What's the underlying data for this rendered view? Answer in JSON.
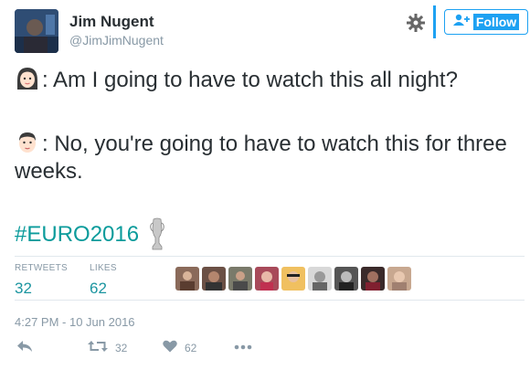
{
  "user": {
    "name": "Jim Nugent",
    "handle": "@JimJimNugent"
  },
  "follow": {
    "label": "Follow"
  },
  "tweet": {
    "line1": ": Am I going to have to watch this all night?",
    "line2": ": No, you're going to have to watch this for three weeks.",
    "hashtag": "#EURO2016"
  },
  "stats": {
    "retweets_label": "RETWEETS",
    "retweets_value": "32",
    "likes_label": "LIKES",
    "likes_value": "62"
  },
  "timestamp": "4:27 PM - 10 Jun 2016",
  "actions": {
    "reply_icon": "reply-icon",
    "retweet_count": "32",
    "like_count": "62",
    "more_icon": "more-icon"
  },
  "colors": {
    "accent": "#1da1f2",
    "hashtag": "#0a9b9b",
    "stat_value": "#1b95a0",
    "muted": "#8899a6"
  }
}
